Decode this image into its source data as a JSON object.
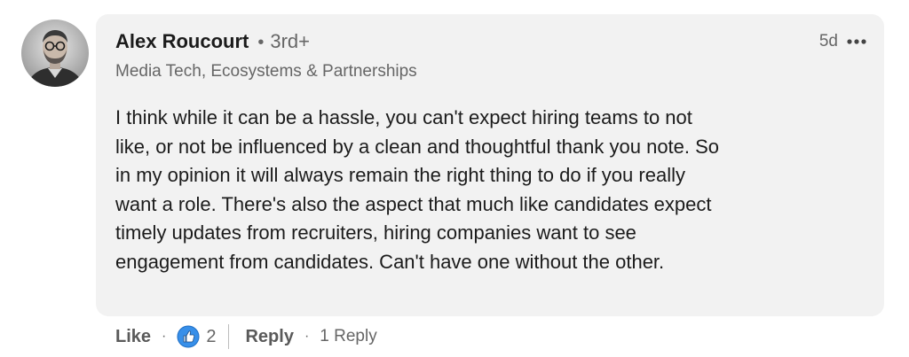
{
  "author": {
    "name": "Alex Roucourt",
    "degree_separator": "•",
    "degree": "3rd+",
    "headline": "Media Tech, Ecosystems & Partnerships",
    "avatar_icon": "person-photo"
  },
  "meta": {
    "timestamp": "5d",
    "more_icon": "ellipsis-icon"
  },
  "comment": {
    "lines": [
      "I think while it can be a hassle, you can't expect hiring teams to not",
      "like, or not be influenced by a clean and thoughtful thank you note. So",
      "in my opinion it will always remain the right thing to do if you really",
      "want a role. There's also the aspect that much like candidates expect",
      "timely updates from recruiters, hiring companies want to see",
      "engagement from candidates. Can't have one without the other."
    ]
  },
  "actions": {
    "like_label": "Like",
    "separator": "·",
    "reaction_icon": "thumbs-up-icon",
    "reaction_count": "2",
    "reply_label": "Reply",
    "replies_label": "1 Reply"
  },
  "colors": {
    "bubble_bg": "#f2f2f2",
    "text_primary": "#1b1b1b",
    "text_secondary": "#666666",
    "like_blue": "#378fe9"
  }
}
